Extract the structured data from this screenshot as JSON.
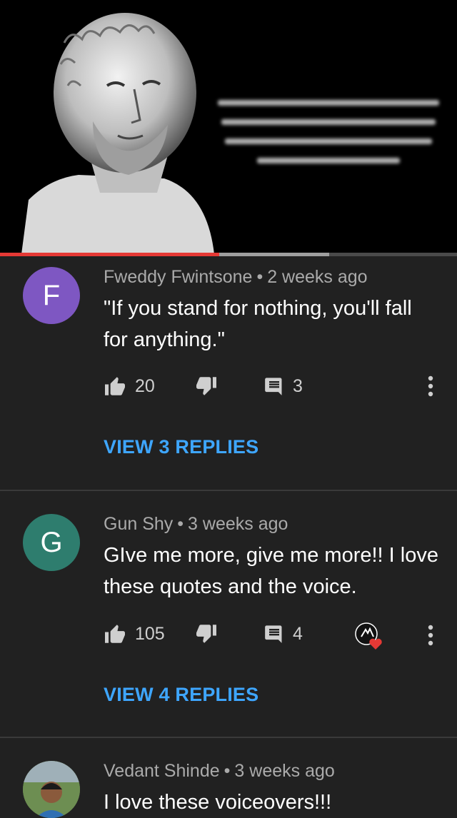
{
  "comments": [
    {
      "avatar_letter": "F",
      "avatar_color": "#7e57c2",
      "author": "Fweddy Fwintsone",
      "time": "2 weeks ago",
      "text": "\"If you stand for nothing, you'll fall for anything.\"",
      "likes": "20",
      "reply_count": "3",
      "replies_label": "VIEW 3 REPLIES"
    },
    {
      "avatar_letter": "G",
      "avatar_color": "#2e7d6e",
      "author": "Gun Shy",
      "time": "3 weeks ago",
      "text": "GIve me more, give me more!! I love these quotes and the voice.",
      "likes": "105",
      "reply_count": "4",
      "replies_label": "VIEW 4 REPLIES"
    },
    {
      "author": "Vedant Shinde",
      "time": "3 weeks ago",
      "text": "I love these voiceovers!!!"
    }
  ],
  "meta_separator": "•",
  "video": {
    "progress_played": 0.48,
    "progress_buffered": 0.72
  },
  "colors": {
    "accent_link": "#3ea6ff",
    "progress": "#e53935",
    "heart": "#e53935"
  }
}
